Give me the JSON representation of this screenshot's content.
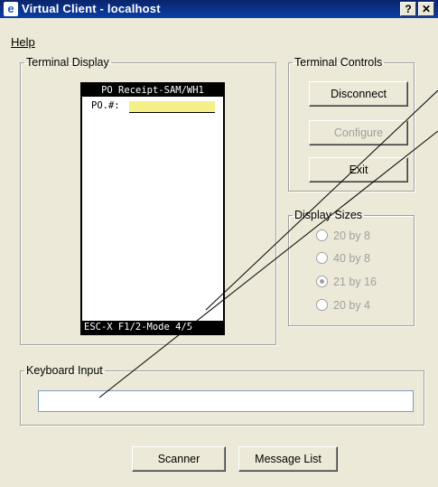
{
  "window": {
    "title": "Virtual Client - localhost",
    "app_icon": "virtual-client-icon",
    "help_button": "?",
    "close_button": "✕"
  },
  "menu": {
    "help": "Help"
  },
  "terminal_display": {
    "legend": "Terminal Display",
    "header": "PO Receipt-SAM/WH1",
    "prompt": "PO.#:",
    "footer": "ESC-X F1/2-Mode 4/5",
    "field_color": "#F5F087"
  },
  "terminal_controls": {
    "legend": "Terminal Controls",
    "disconnect": "Disconnect",
    "configure": "Configure",
    "exit": "Exit"
  },
  "display_sizes": {
    "legend": "Display Sizes",
    "options": [
      {
        "label": "20 by 8",
        "checked": false
      },
      {
        "label": "40 by 8",
        "checked": false
      },
      {
        "label": "21 by 16",
        "checked": true
      },
      {
        "label": "20 by 4",
        "checked": false
      }
    ]
  },
  "keyboard_input": {
    "legend": "Keyboard Input",
    "value": ""
  },
  "bottom_buttons": {
    "scanner": "Scanner",
    "message_list": "Message List"
  },
  "colors": {
    "title_bar": "#0A246A",
    "window_bg": "#ECE9D8",
    "disabled_text": "#A0A0A0"
  }
}
